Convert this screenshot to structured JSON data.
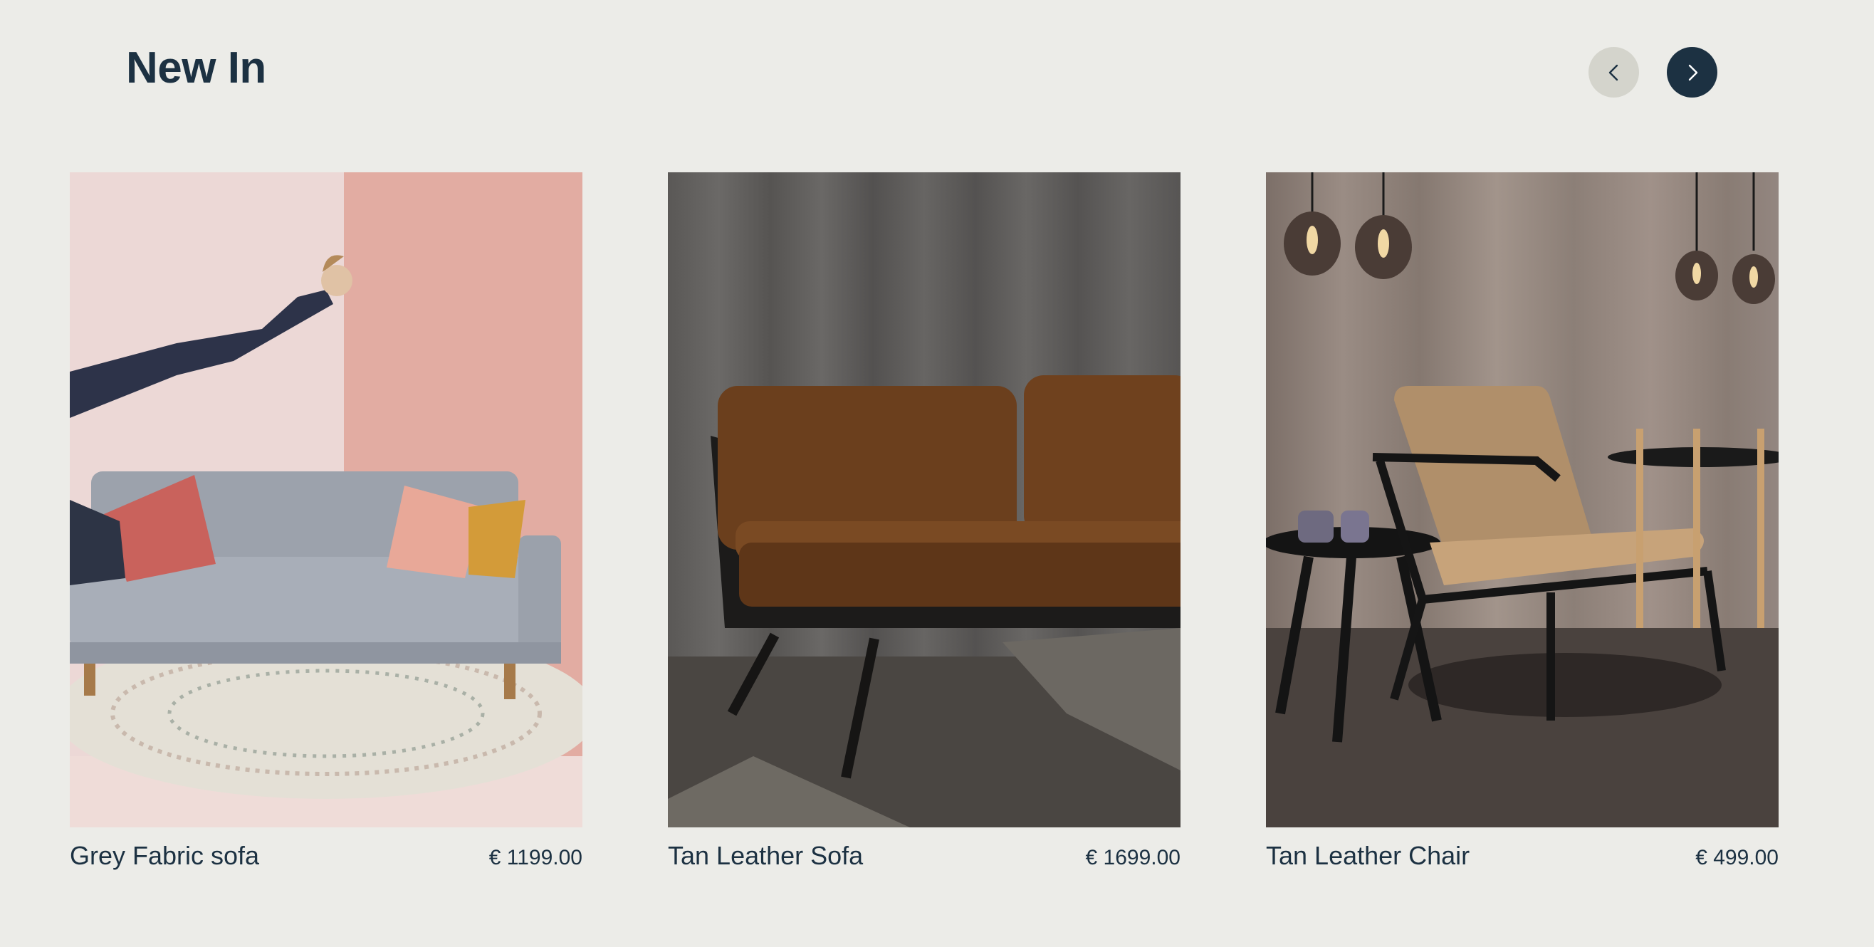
{
  "section": {
    "title": "New In"
  },
  "carousel": {
    "prev_icon": "chevron-left-icon",
    "next_icon": "chevron-right-icon",
    "prev_color": "#d4d4cc",
    "next_color": "#1c3142"
  },
  "products": [
    {
      "name": "Grey Fabric sofa",
      "price": "€ 1199.00",
      "image": "grey-fabric-sofa-photo"
    },
    {
      "name": "Tan Leather Sofa",
      "price": "€ 1699.00",
      "image": "tan-leather-sofa-photo"
    },
    {
      "name": "Tan Leather Chair",
      "price": "€ 499.00",
      "image": "tan-leather-chair-photo"
    }
  ]
}
